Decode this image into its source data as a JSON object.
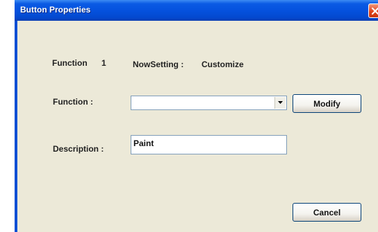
{
  "window": {
    "title": "Button Properties"
  },
  "info": {
    "function_label": "Function",
    "function_number": "1",
    "now_setting_label": "NowSetting :",
    "now_setting_value": "Customize"
  },
  "function_field": {
    "label": "Function :",
    "selected_value": ""
  },
  "description_field": {
    "label": "Description :",
    "value": "Paint"
  },
  "buttons": {
    "modify_label": "Modify",
    "cancel_label": "Cancel"
  },
  "colors": {
    "titlebar": "#0552de",
    "dialog_background": "#ece9d8",
    "close_button": "#e0431a"
  },
  "icons": {
    "close": "close-icon",
    "dropdown": "chevron-down-icon"
  }
}
